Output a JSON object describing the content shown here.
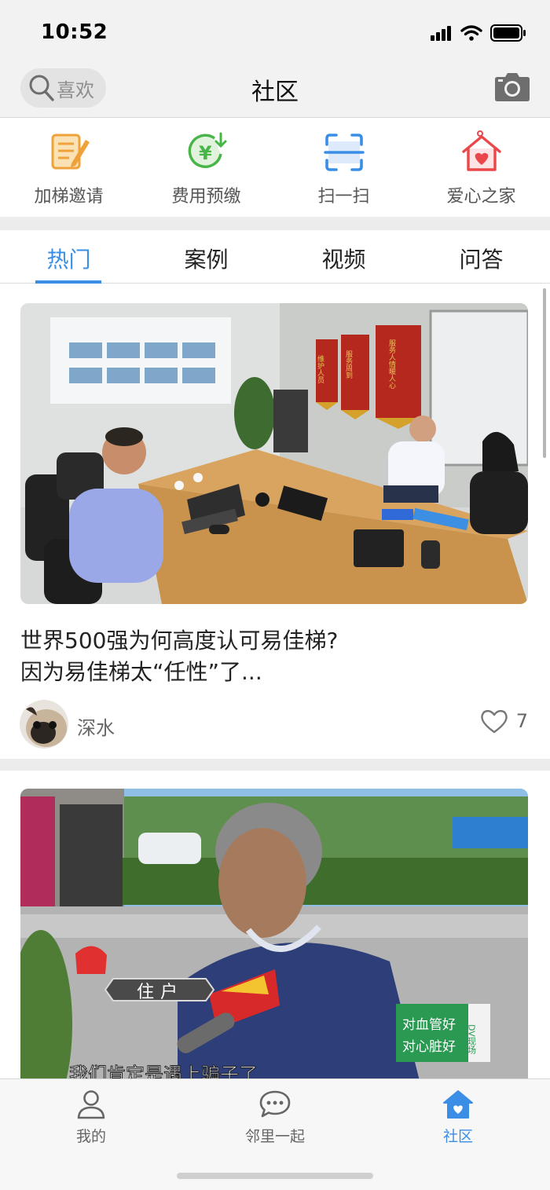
{
  "status_bar": {
    "time": "10:52"
  },
  "nav": {
    "search_placeholder": "喜欢",
    "title": "社区",
    "camera_icon": "camera-icon"
  },
  "quick_actions": [
    {
      "label": "加梯邀请",
      "icon": "invite-doc-icon",
      "color": "#f0a23a"
    },
    {
      "label": "费用预缴",
      "icon": "yen-prepay-icon",
      "color": "#47b548"
    },
    {
      "label": "扫一扫",
      "icon": "scan-icon",
      "color": "#3a8ee6"
    },
    {
      "label": "爱心之家",
      "icon": "love-home-icon",
      "color": "#e9474a"
    }
  ],
  "tabs": [
    {
      "label": "热门",
      "active": true
    },
    {
      "label": "案例",
      "active": false
    },
    {
      "label": "视频",
      "active": false
    },
    {
      "label": "问答",
      "active": false
    }
  ],
  "feed": [
    {
      "title_line1": "世界500强为何高度认可易佳梯?",
      "title_line2": "因为易佳梯太“任性”了...",
      "author": "深水",
      "likes": "7",
      "photo_scene": "meeting-room-photo",
      "banner_text": [
        "维护人员",
        "服务周到",
        "服务人情暖人心"
      ]
    },
    {
      "photo_scene": "news-interview-photo",
      "caption_tag": "住户",
      "subtitle": "我们肯定是遇上骗子了",
      "badge_lines": [
        "对血管好",
        "对心脏好"
      ],
      "badge_side": "DV现场"
    }
  ],
  "tab_bar": [
    {
      "label": "我的",
      "icon": "person-icon",
      "active": false
    },
    {
      "label": "邻里一起",
      "icon": "chat-bubble-icon",
      "active": false
    },
    {
      "label": "社区",
      "icon": "community-home-icon",
      "active": true
    }
  ],
  "colors": {
    "accent": "#3a8ee6",
    "background": "#f2f2f2"
  }
}
